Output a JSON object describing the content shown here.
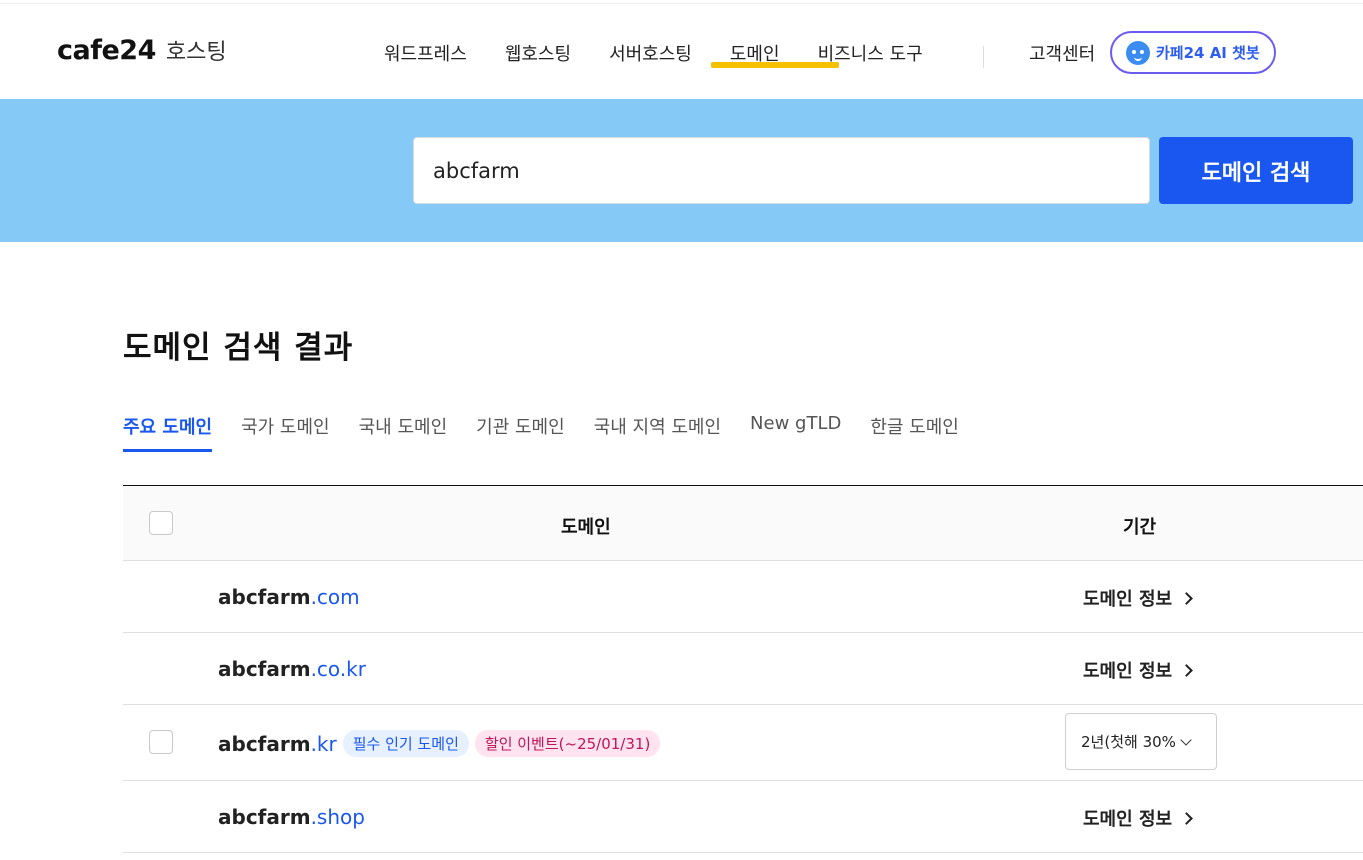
{
  "header": {
    "logo": "cafe24",
    "logo_sub": "호스팅",
    "nav": [
      "워드프레스",
      "웹호스팅",
      "서버호스팅",
      "도메인",
      "비즈니스 도구"
    ],
    "support": "고객센터",
    "chatbot": "카페24 AI 챗봇",
    "accent_color": "#f5c000"
  },
  "search": {
    "value": "abcfarm",
    "button": "도메인 검색",
    "band_color": "#85c9f7",
    "button_color": "#1a57f0"
  },
  "results": {
    "title": "도메인 검색 결과",
    "tabs": [
      "주요 도메인",
      "국가 도메인",
      "국내 도메인",
      "기관 도메인",
      "국내 지역 도메인",
      "New gTLD",
      "한글 도메인"
    ],
    "columns": {
      "domain": "도메인",
      "period": "기간"
    },
    "rows": [
      {
        "name": "abcfarm",
        "tld": ".com",
        "action": "도메인 정보"
      },
      {
        "name": "abcfarm",
        "tld": ".co.kr",
        "action": "도메인 정보"
      },
      {
        "name": "abcfarm",
        "tld": ".kr",
        "badge1": "필수 인기 도메인",
        "badge2": "할인 이벤트(~25/01/31)",
        "period": "2년(첫해 30%"
      },
      {
        "name": "abcfarm",
        "tld": ".shop",
        "action": "도메인 정보"
      }
    ]
  }
}
